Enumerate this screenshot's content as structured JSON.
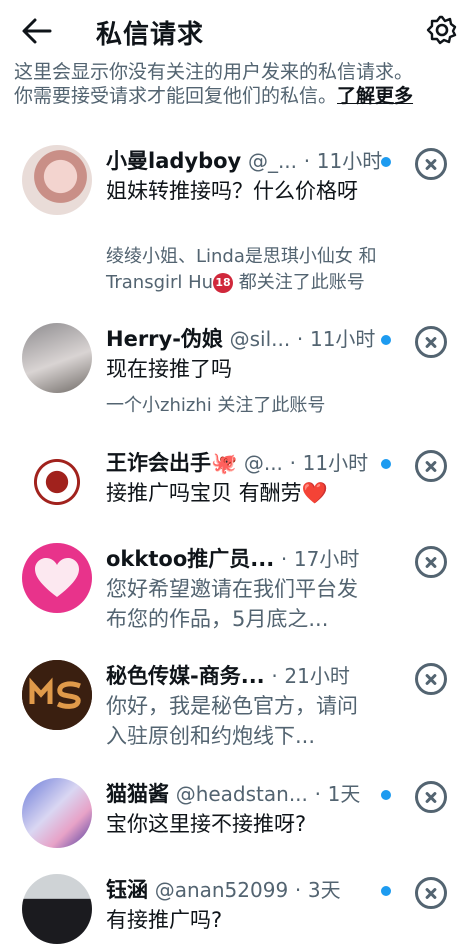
{
  "header": {
    "title": "私信请求"
  },
  "info": {
    "line1": "这里会显示你没有关注的用户发来的私信请求。",
    "line2": "你需要接受请求才能回复他们的私信。",
    "learn_more": "了解更多"
  },
  "requests": [
    {
      "name": "小曼ladyboy",
      "handle": "@_...",
      "time": "11小时",
      "unread": true,
      "message": "姐妹转推接吗？什么价格呀",
      "followed_by": "绫绫小姐、Linda是思琪小仙女 和 Transgirl Hu",
      "followed_by_emoji": "18",
      "followed_suffix": " 都关注了此账号"
    },
    {
      "name": "Herry-伪娘",
      "handle": "@sil...",
      "time": "11小时",
      "unread": true,
      "message": "现在接推了吗",
      "followed_by": "一个小zhizhi 关注了此账号"
    },
    {
      "name": "王诈会出手🐙",
      "handle": "@...",
      "time": "11小时",
      "unread": true,
      "message": "接推广吗宝贝 有酬劳❤️"
    },
    {
      "name": "okktoo推广员...",
      "handle": "",
      "time": "17小时",
      "unread": false,
      "message": "您好希望邀请在我们平台发布您的作品，5月底之..."
    },
    {
      "name": "秘色传媒-商务...",
      "handle": "",
      "time": "21小时",
      "unread": false,
      "message": "你好，我是秘色官方，请问入驻原创和约炮线下..."
    },
    {
      "name": "猫猫酱",
      "handle": "@headstan...",
      "time": "1天",
      "unread": true,
      "message": "宝你这里接不接推呀?"
    },
    {
      "name": "钰涵",
      "handle": "@anan52099",
      "time": "3天",
      "unread": true,
      "message": "有接推广吗?"
    }
  ],
  "colors": {
    "accent": "#1d9bf0",
    "secondary_text": "#536471"
  }
}
